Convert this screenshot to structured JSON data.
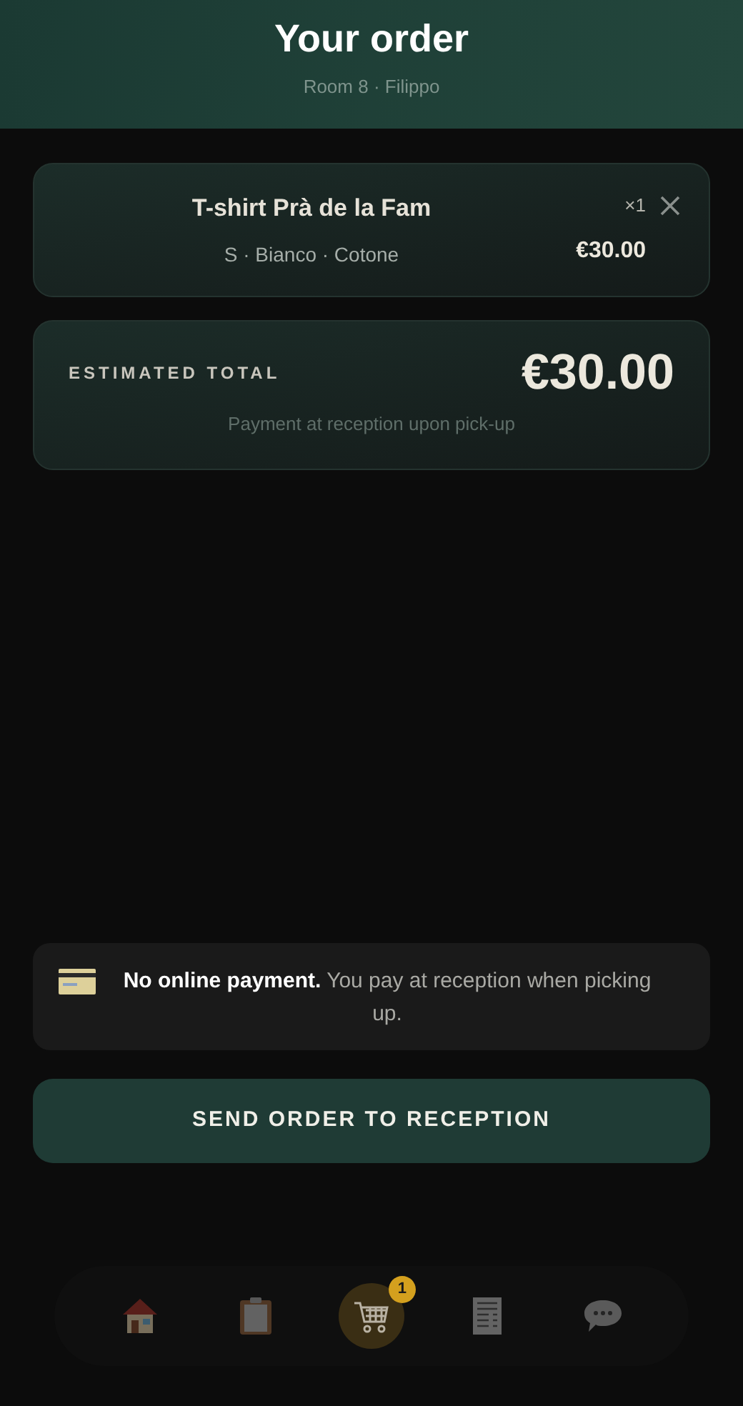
{
  "header": {
    "title": "Your order",
    "subtitle": "Room 8 · Filippo"
  },
  "items": [
    {
      "name": "T-shirt Prà de la Fam",
      "details": "S · Bianco · Cotone",
      "quantity": "×1",
      "price": "€30.00"
    }
  ],
  "total": {
    "label": "ESTIMATED TOTAL",
    "amount": "€30.00",
    "note": "Payment at reception upon pick-up"
  },
  "notice": {
    "text": "**No online payment.** You pay at reception when picking up."
  },
  "submit_button": "SEND ORDER TO RECEPTION",
  "nav": [
    {
      "kind": "home",
      "selected": false
    },
    {
      "kind": "clipboard",
      "selected": false
    },
    {
      "kind": "cart",
      "selected": true,
      "badge": "1"
    },
    {
      "kind": "receipt",
      "selected": false
    },
    {
      "kind": "chat",
      "selected": false
    }
  ]
}
